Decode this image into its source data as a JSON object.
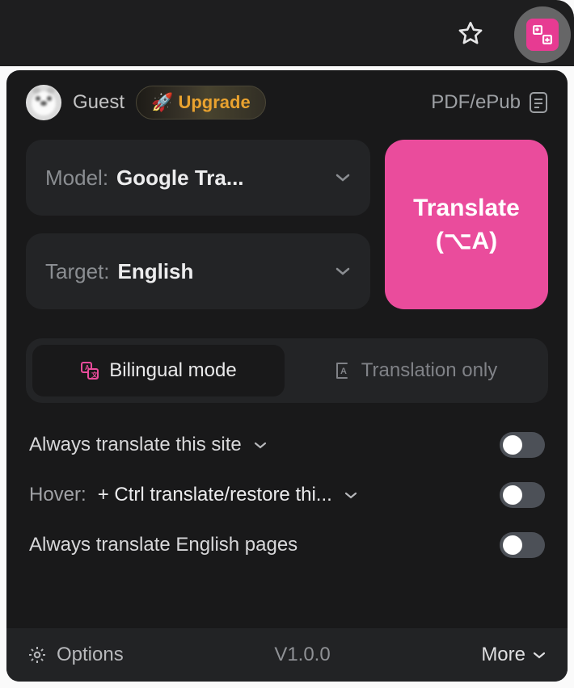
{
  "header": {
    "guest_label": "Guest",
    "upgrade_label": "Upgrade",
    "pdf_label": "PDF/ePub"
  },
  "model_select": {
    "label": "Model:",
    "value": "Google Tra..."
  },
  "target_select": {
    "label": "Target:",
    "value": "English"
  },
  "translate_button": {
    "label": "Translate",
    "shortcut": "(⌥A)"
  },
  "mode": {
    "bilingual": "Bilingual mode",
    "translation_only": "Translation only"
  },
  "settings": {
    "always_translate_site": "Always translate this site",
    "hover_prefix": "Hover:",
    "hover_value": "+ Ctrl translate/restore thi...",
    "always_translate_lang": "Always translate English pages"
  },
  "footer": {
    "options": "Options",
    "version": "V1.0.0",
    "more": "More"
  }
}
